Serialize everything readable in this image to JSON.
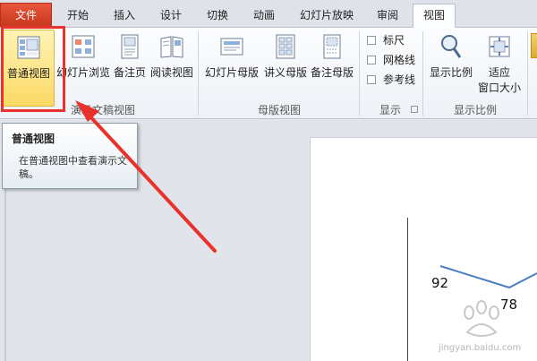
{
  "tabs": [
    {
      "label": "文件"
    },
    {
      "label": "开始"
    },
    {
      "label": "插入"
    },
    {
      "label": "设计"
    },
    {
      "label": "切换"
    },
    {
      "label": "动画"
    },
    {
      "label": "幻灯片放映"
    },
    {
      "label": "审阅"
    },
    {
      "label": "视图"
    }
  ],
  "ribbon": {
    "presentation_views": {
      "group_label": "演示文稿视图",
      "buttons": [
        {
          "label": "普通视图",
          "icon": "normal-view-icon"
        },
        {
          "label": "幻灯片浏览",
          "icon": "slide-sorter-icon"
        },
        {
          "label": "备注页",
          "icon": "notes-page-icon"
        },
        {
          "label": "阅读视图",
          "icon": "reading-view-icon"
        }
      ]
    },
    "master_views": {
      "group_label": "母版视图",
      "buttons": [
        {
          "label": "幻灯片母版",
          "icon": "slide-master-icon"
        },
        {
          "label": "讲义母版",
          "icon": "handout-master-icon"
        },
        {
          "label": "备注母版",
          "icon": "notes-master-icon"
        }
      ]
    },
    "show": {
      "group_label": "显示",
      "checkboxes": [
        {
          "label": "标尺",
          "checked": false
        },
        {
          "label": "网格线",
          "checked": false
        },
        {
          "label": "参考线",
          "checked": false
        }
      ]
    },
    "zoom": {
      "group_label": "显示比例",
      "buttons": [
        {
          "label": "显示比例",
          "icon": "zoom-icon"
        },
        {
          "label": "适应窗口大小",
          "line1": "适应",
          "line2": "窗口大小",
          "icon": "fit-to-window-icon"
        }
      ]
    }
  },
  "tooltip": {
    "title": "普通视图",
    "body": "在普通视图中查看演示文稿。"
  },
  "chart_data": {
    "type": "line",
    "series": [
      {
        "values": [
          92,
          78
        ]
      }
    ],
    "data_labels": [
      "92",
      "78"
    ]
  },
  "watermark": {
    "url": "jingyan.baidu.com"
  },
  "colors": {
    "file_tab": "#d24726",
    "selected_button": "#fbd964",
    "annotation_red": "#e8322b",
    "chart_line": "#4a7fc1"
  }
}
